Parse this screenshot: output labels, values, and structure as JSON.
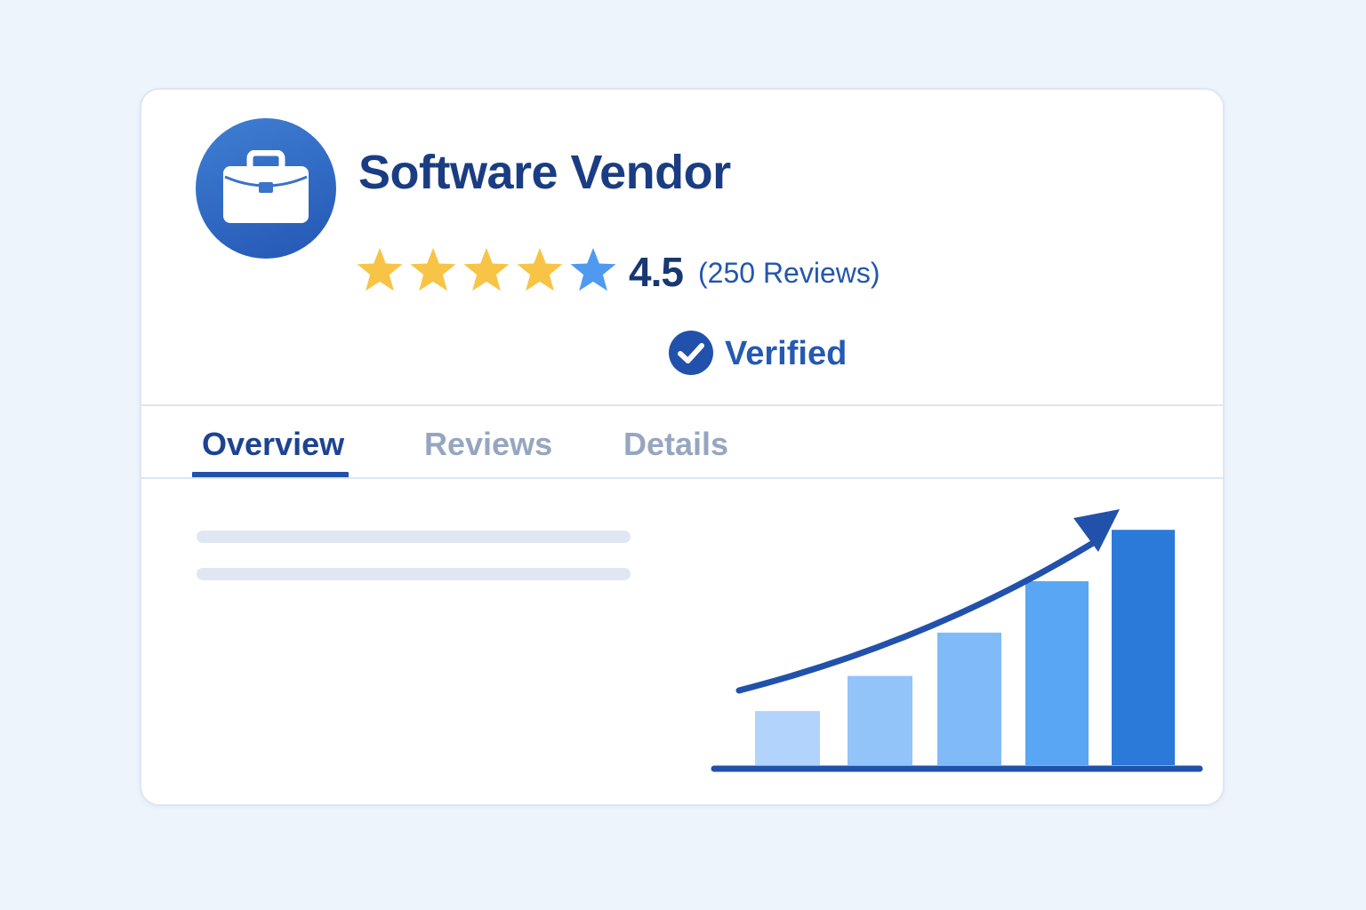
{
  "vendor": {
    "name": "Software Vendor",
    "logo_icon": "briefcase-icon",
    "rating": 4.5,
    "rating_text": "4.5",
    "review_count_text": "(250 Reviews)",
    "verified_label": "Verified",
    "verified_icon": "check-circle-icon"
  },
  "rating_stars": {
    "max": 5,
    "value": 4.5
  },
  "tabs": [
    {
      "label": "Overview",
      "active": true
    },
    {
      "label": "Reviews",
      "active": false
    },
    {
      "label": "Details",
      "active": false
    }
  ],
  "colors": {
    "background": "#eef4fc",
    "accent": "#2151ab",
    "title": "#1a3c82",
    "star_filled": "#f8c446",
    "star_partial": "#4f9af0",
    "inactive_tab": "#96a6c0",
    "skeleton": "#e1e7f2"
  },
  "chart_data": {
    "type": "bar",
    "categories": [
      "",
      "",
      "",
      "",
      ""
    ],
    "values": [
      1.0,
      1.65,
      2.45,
      3.4,
      4.35
    ],
    "ylim": [
      0,
      4.6
    ],
    "grid": false,
    "trend_arrow": true,
    "bar_colors": [
      "#b2d3fb",
      "#93c4f9",
      "#80bbf8",
      "#58a6f4",
      "#2b79d8"
    ],
    "axis_color": "#2151ab"
  }
}
